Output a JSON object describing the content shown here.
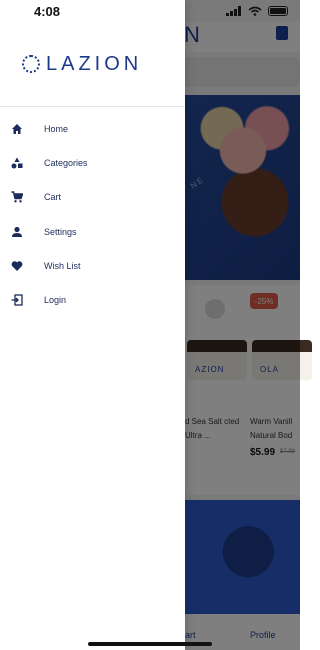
{
  "status_bar": {
    "time": "4:08"
  },
  "background": {
    "header_logo_fragment": "N",
    "banner_text_fragment": "NE",
    "products": [
      {
        "name": "d Sea Salt cted Ultra ...",
        "price": "",
        "old_price": "",
        "jar_label": "AZION"
      },
      {
        "name": "Warm Vanill Natural Bod",
        "price": "$5.99",
        "old_price": "$7.99",
        "discount": "-25%",
        "jar_label": "OLA"
      }
    ],
    "tabbar": {
      "cart_label_fragment": "art",
      "profile_label": "Profile"
    }
  },
  "drawer": {
    "logo_text": "LAZION",
    "menu": [
      {
        "label": "Home",
        "icon": "home-icon"
      },
      {
        "label": "Categories",
        "icon": "categories-icon"
      },
      {
        "label": "Cart",
        "icon": "cart-icon"
      },
      {
        "label": "Settings",
        "icon": "person-icon"
      },
      {
        "label": "Wish List",
        "icon": "heart-icon"
      },
      {
        "label": "Login",
        "icon": "login-icon"
      }
    ]
  },
  "colors": {
    "brand": "#1c3a8a",
    "discount": "#e05a48"
  }
}
